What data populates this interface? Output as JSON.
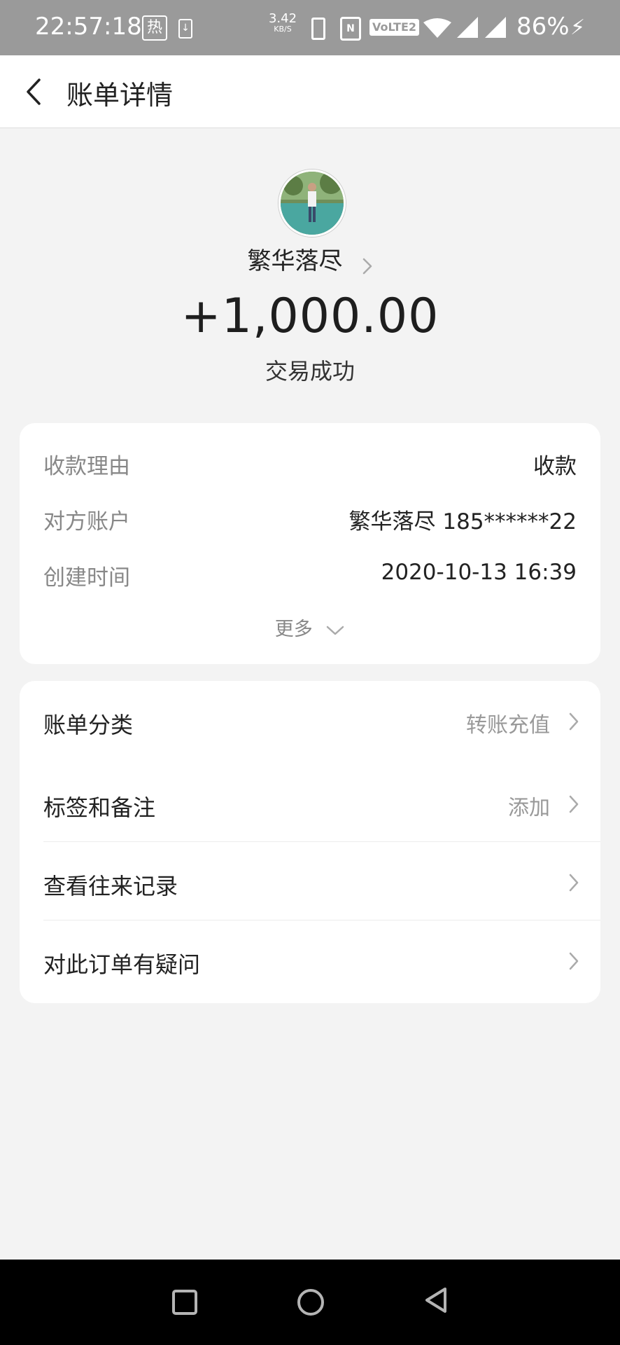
{
  "status_bar": {
    "time": "22:57:18",
    "hot_badge": "热",
    "net_speed": "3.42",
    "net_speed_unit": "KB/S",
    "volte": "VoLTE2",
    "battery": "86%"
  },
  "header": {
    "title": "账单详情"
  },
  "profile": {
    "name": "繁华落尽",
    "amount": "+1,000.00",
    "status": "交易成功"
  },
  "details": {
    "rows": [
      {
        "label": "收款理由",
        "value": "收款"
      },
      {
        "label": "对方账户",
        "value": "繁华落尽 185******22"
      },
      {
        "label": "创建时间",
        "value": "2020-10-13 16:39"
      }
    ],
    "more_label": "更多"
  },
  "menu": {
    "items": [
      {
        "label": "账单分类",
        "value": "转账充值"
      },
      {
        "label": "标签和备注",
        "value": "添加"
      },
      {
        "label": "查看往来记录",
        "value": ""
      },
      {
        "label": "对此订单有疑问",
        "value": ""
      }
    ]
  },
  "colors": {
    "background": "#f3f3f3",
    "status_bar": "#9a9a9a",
    "card": "#ffffff",
    "muted_text": "#888888"
  }
}
